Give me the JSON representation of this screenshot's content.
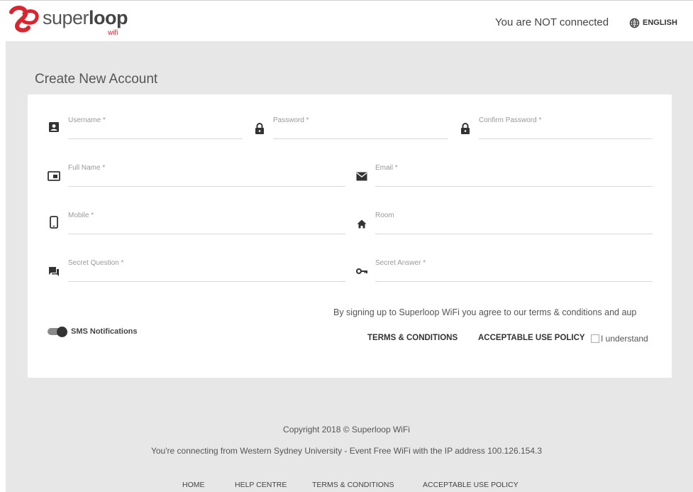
{
  "header": {
    "logo_word_light": "super",
    "logo_word_bold": "loop",
    "logo_sub": "wifi",
    "connection_status": "You are NOT connected",
    "language": "ENGLISH"
  },
  "page_title": "Create New Account",
  "form": {
    "username": {
      "label": "Username *",
      "value": ""
    },
    "password": {
      "label": "Password *",
      "value": ""
    },
    "confirm_password": {
      "label": "Confirm Password *",
      "value": ""
    },
    "full_name": {
      "label": "Full Name *",
      "value": ""
    },
    "email": {
      "label": "Email *",
      "value": ""
    },
    "mobile": {
      "label": "Mobile *",
      "value": ""
    },
    "room": {
      "label": "Room",
      "value": ""
    },
    "secret_question": {
      "label": "Secret Question *",
      "value": ""
    },
    "secret_answer": {
      "label": "Secret Answer *",
      "value": ""
    }
  },
  "sms_notifications": {
    "label": "SMS Notifications",
    "enabled": true
  },
  "agreement": {
    "text": "By signing up to Superloop WiFi you agree to our terms & conditions and aup",
    "terms_link": "TERMS & CONDITIONS",
    "aup_link": "ACCEPTABLE USE POLICY",
    "checkbox_label": "I understand",
    "checked": false
  },
  "footer": {
    "copyright": "Copyright 2018 © Superloop WiFi",
    "connection_info": "You're connecting from Western Sydney University - Event Free WiFi with the IP address 100.126.154.3",
    "nav": [
      "HOME",
      "HELP CENTRE",
      "TERMS & CONDITIONS",
      "ACCEPTABLE USE POLICY"
    ]
  },
  "colors": {
    "brand_red": "#d7262f",
    "page_bg": "#e7e7e7",
    "card_bg": "#ffffff"
  }
}
